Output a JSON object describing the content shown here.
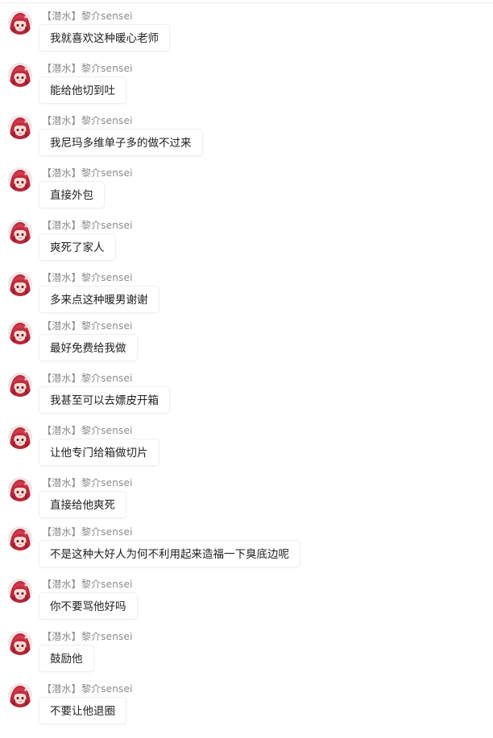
{
  "chat": {
    "messages": [
      {
        "sender_tag": "【潜水】",
        "sender_name": "黎介sensei",
        "text": "我就喜欢这种暖心老师"
      },
      {
        "sender_tag": "【潜水】",
        "sender_name": "黎介sensei",
        "text": "能给他切到吐"
      },
      {
        "sender_tag": "【潜水】",
        "sender_name": "黎介sensei",
        "text": "我尼玛多维单子多的做不过来"
      },
      {
        "sender_tag": "【潜水】",
        "sender_name": "黎介sensei",
        "text": "直接外包"
      },
      {
        "sender_tag": "【潜水】",
        "sender_name": "黎介sensei",
        "text": "爽死了家人"
      },
      {
        "sender_tag": "【潜水】",
        "sender_name": "黎介sensei",
        "text": "多来点这种暖男谢谢"
      },
      {
        "sender_tag": "【潜水】",
        "sender_name": "黎介sensei",
        "text": "最好免费给我做"
      },
      {
        "sender_tag": "【潜水】",
        "sender_name": "黎介sensei",
        "text": "我甚至可以去嫖皮开箱"
      },
      {
        "sender_tag": "【潜水】",
        "sender_name": "黎介sensei",
        "text": "让他专门给箱做切片"
      },
      {
        "sender_tag": "【潜水】",
        "sender_name": "黎介sensei",
        "text": "直接给他爽死"
      },
      {
        "sender_tag": "【潜水】",
        "sender_name": "黎介sensei",
        "text": "不是这种大好人为何不利用起来造福一下臭底边呢"
      },
      {
        "sender_tag": "【潜水】",
        "sender_name": "黎介sensei",
        "text": "你不要骂他好吗"
      },
      {
        "sender_tag": "【潜水】",
        "sender_name": "黎介sensei",
        "text": "鼓励他"
      },
      {
        "sender_tag": "【潜水】",
        "sender_name": "黎介sensei",
        "text": "不要让他退圈"
      }
    ]
  }
}
